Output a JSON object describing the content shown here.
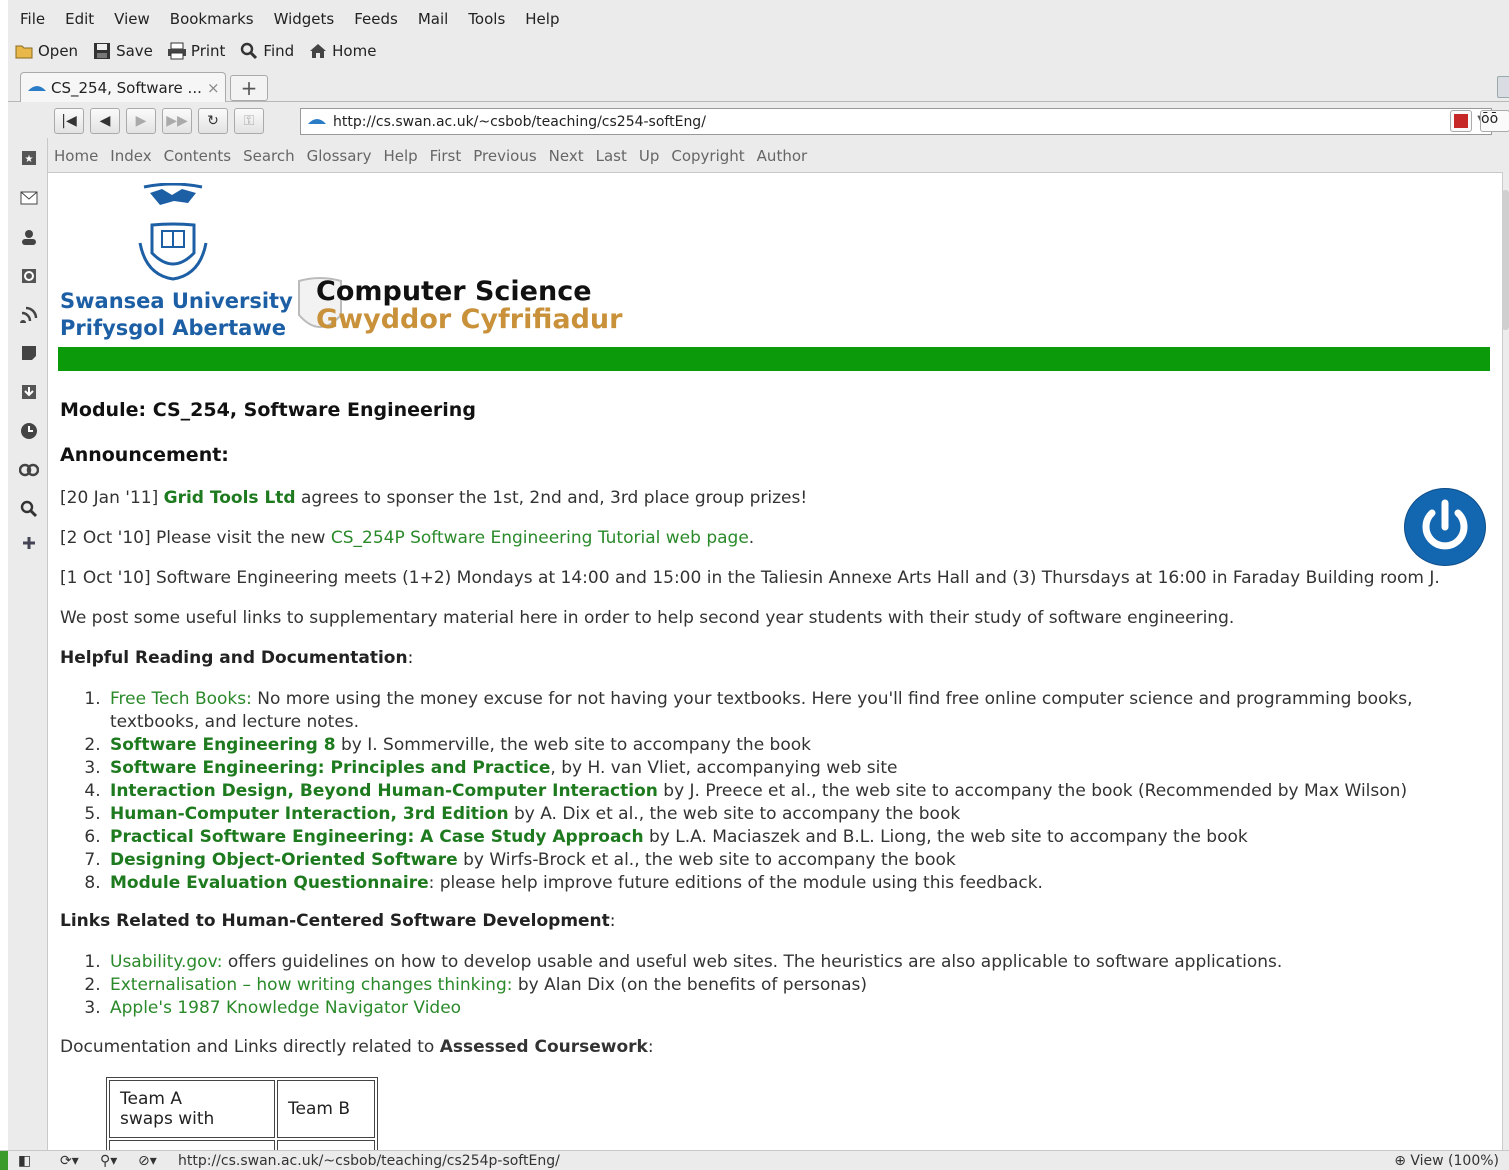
{
  "menubar": [
    "File",
    "Edit",
    "View",
    "Bookmarks",
    "Widgets",
    "Feeds",
    "Mail",
    "Tools",
    "Help"
  ],
  "toolbar": {
    "open": "Open",
    "save": "Save",
    "print": "Print",
    "find": "Find",
    "home": "Home"
  },
  "tab": {
    "title": "CS_254, Software ...",
    "close": "×",
    "new": "+"
  },
  "address": {
    "url": "http://cs.swan.ac.uk/~csbob/teaching/cs254-softEng/"
  },
  "linkbar": [
    "Home",
    "Index",
    "Contents",
    "Search",
    "Glossary",
    "Help",
    "First",
    "Previous",
    "Next",
    "Last",
    "Up",
    "Copyright",
    "Author"
  ],
  "header": {
    "uni_en": "Swansea University",
    "uni_cy": "Prifysgol Abertawe",
    "dept_en": "Computer Science",
    "dept_cy": "Gwyddor Cyfrifiadur"
  },
  "page": {
    "module_title": "Module: CS_254, Software Engineering",
    "announcement_heading": "Announcement:",
    "ann1_pre": "[20 Jan '11] ",
    "ann1_link": "Grid Tools Ltd",
    "ann1_post": " agrees to sponser the 1st, 2nd and, 3rd place group prizes!",
    "ann2_pre": "[2 Oct '10] Please visit the new ",
    "ann2_link": "CS_254P Software Engineering Tutorial web page",
    "ann2_post": ".",
    "ann3": "[1 Oct '10] Software Engineering meets (1+2) Mondays at 14:00 and 15:00 in the Taliesin Annexe Arts Hall and (3) Thursdays at 16:00 in Faraday Building room J.",
    "intro": "We post some useful links to supplementary material here in order to help second year students with their study of software engineering.",
    "reading_heading": "Helpful Reading and Documentation",
    "reading": [
      {
        "link": "Free Tech Books:",
        "text": " No more using the money excuse for not having your textbooks. Here you'll find free online computer science and programming books,",
        "text2": "textbooks, and lecture notes."
      },
      {
        "link": "Software Engineering 8",
        "text": " by I. Sommerville, the web site to accompany the book"
      },
      {
        "link": "Software Engineering: Principles and Practice",
        "text": ", by H. van Vliet, accompanying web site"
      },
      {
        "link": "Interaction Design, Beyond Human-Computer Interaction",
        "text": " by J. Preece et al., the web site to accompany the book (Recommended by Max Wilson)"
      },
      {
        "link": "Human-Computer Interaction, 3rd Edition",
        "text": " by A. Dix et al., the web site to accompany the book"
      },
      {
        "link": "Practical Software Engineering: A Case Study Approach",
        "text": " by L.A. Maciaszek and B.L. Liong, the web site to accompany the book"
      },
      {
        "link": "Designing Object-Oriented Software",
        "text": " by Wirfs-Brock et al., the web site to accompany the book"
      },
      {
        "link": "Module Evaluation Questionnaire",
        "text": ": please help improve future editions of the module using this feedback."
      }
    ],
    "hcsd_heading": "Links Related to Human-Centered Software Development",
    "hcsd": [
      {
        "link": "Usability.gov:",
        "text": " offers guidelines on how to develop usable and useful web sites. The heuristics are also applicable to software applications."
      },
      {
        "link": "Externalisation – how writing changes thinking:",
        "text": " by Alan Dix (on the benefits of personas)"
      },
      {
        "link": "Apple's 1987 Knowledge Navigator Video",
        "text": ""
      }
    ],
    "cw_pre": "Documentation and Links directly related to ",
    "cw_bold": "Assessed Coursework",
    "cw_post": ":",
    "table": {
      "a1": "Team A",
      "a2": "swaps with",
      "b": "Team B"
    }
  },
  "status": {
    "url": "http://cs.swan.ac.uk/~csbob/teaching/cs254p-softEng/",
    "zoom": "View (100%)"
  },
  "colors": {
    "link": "#2a8a2a",
    "green_bar": "#0a9a0a",
    "uni_blue": "#1c5fa5",
    "welsh_gold": "#c8913a",
    "power_blue": "#1366b0"
  }
}
